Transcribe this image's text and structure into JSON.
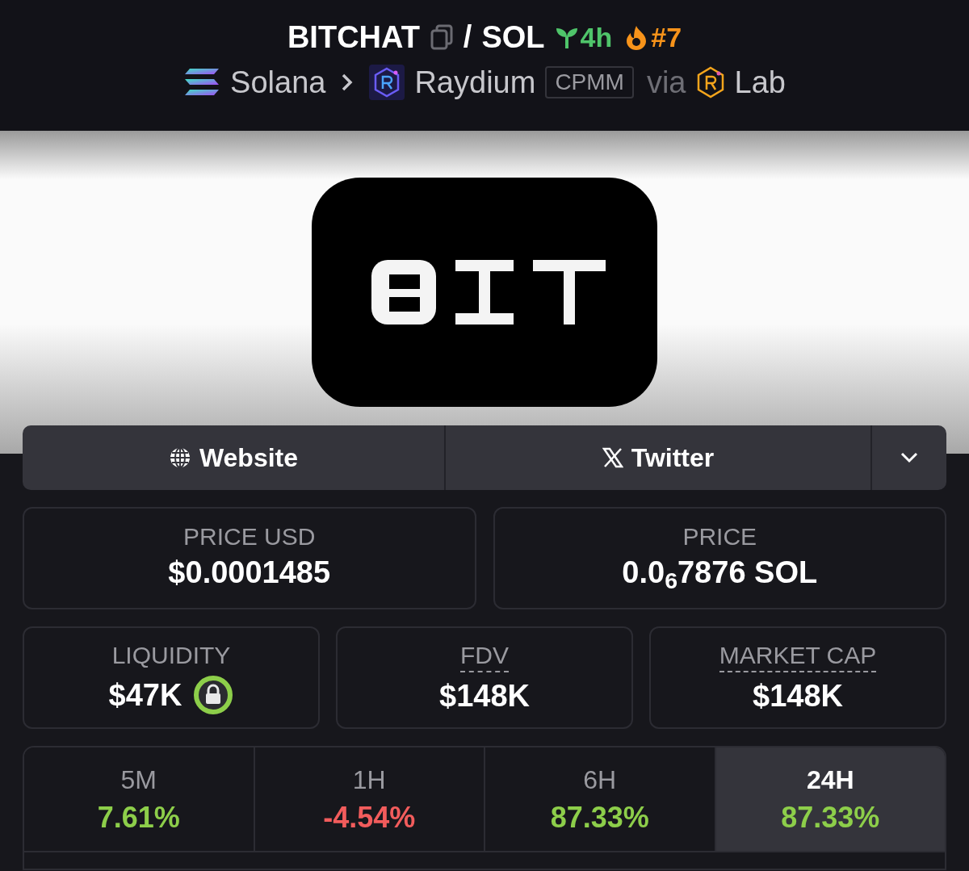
{
  "header": {
    "token": "BITCHAT",
    "separator": "/",
    "quote": "SOL",
    "age": "4h",
    "rank": "#7",
    "chain": "Solana",
    "dex": "Raydium",
    "pool_type": "CPMM",
    "via": "via",
    "launchpad": "Lab"
  },
  "links": [
    {
      "label": "Website",
      "kind": "website"
    },
    {
      "label": "Twitter",
      "kind": "twitter"
    }
  ],
  "prices": [
    {
      "label": "PRICE USD",
      "value": "$0.0001485"
    },
    {
      "label": "PRICE",
      "value": "0.0$_{6}$7876 SOL"
    }
  ],
  "stats": [
    {
      "label": "LIQUIDITY",
      "value": "$47K",
      "dotted": false,
      "locked": true
    },
    {
      "label": "FDV",
      "value": "$148K",
      "dotted": true,
      "locked": false
    },
    {
      "label": "MARKET CAP",
      "value": "$148K",
      "dotted": true,
      "locked": false
    }
  ],
  "changes": [
    {
      "label": "5M",
      "value": "7.61%",
      "kind": "gain",
      "selected": false
    },
    {
      "label": "1H",
      "value": "-4.54%",
      "kind": "loss",
      "selected": false
    },
    {
      "label": "6H",
      "value": "87.33%",
      "kind": "gain",
      "selected": false
    },
    {
      "label": "24H",
      "value": "87.33%",
      "kind": "gain",
      "selected": true
    }
  ]
}
